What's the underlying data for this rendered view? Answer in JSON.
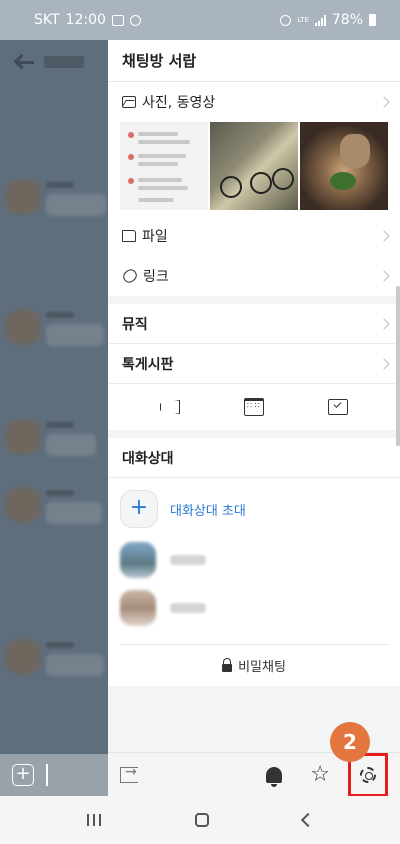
{
  "status_bar": {
    "carrier": "SKT",
    "time": "12:00",
    "network": "LTE",
    "battery": "78%"
  },
  "drawer": {
    "title": "채팅방 서랍",
    "media": {
      "photos_label": "사진, 동영상",
      "files_label": "파일",
      "links_label": "링크"
    },
    "music_label": "뮤직",
    "board_label": "톡게시판",
    "quick_icons": [
      "megaphone-icon",
      "calendar-icon",
      "vote-box-icon"
    ],
    "members": {
      "title": "대화상대",
      "invite_label": "대화상대 초대",
      "invite_icon": "+"
    },
    "secret_chat_label": "비밀채팅"
  },
  "toolbar": {
    "icons": [
      "exit-icon",
      "bell-icon",
      "star-icon",
      "gear-icon"
    ]
  },
  "annotation": {
    "step_number": "2",
    "highlight_color": "#e51c1c",
    "badge_color": "#e3763f"
  },
  "colors": {
    "accent": "#2b7bd6",
    "overlay": "#5f6e7c"
  }
}
